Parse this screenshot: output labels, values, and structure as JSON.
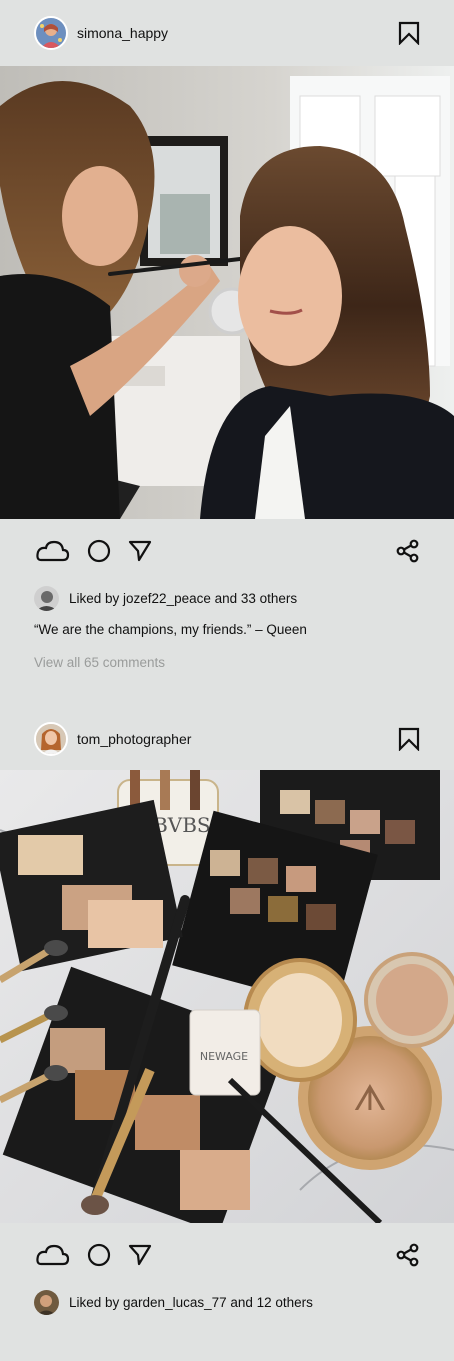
{
  "posts": [
    {
      "username": "simona_happy",
      "bookmark_icon": "bookmark-icon",
      "photo_description_icon": "photo-makeup-artist",
      "actions": {
        "like_icon": "cloud-icon",
        "comment_icon": "circle-icon",
        "send_icon": "send-icon",
        "share_icon": "share-icon"
      },
      "likes_text": "Liked by jozef22_peace and 33 others",
      "caption": "“We are the champions, my friends.” – Queen",
      "comments_link": "View all 65 comments"
    },
    {
      "username": "tom_photographer",
      "bookmark_icon": "bookmark-icon",
      "photo_description_icon": "photo-makeup-products",
      "actions": {
        "like_icon": "cloud-icon",
        "comment_icon": "circle-icon",
        "send_icon": "send-icon",
        "share_icon": "share-icon"
      },
      "likes_text": "Liked by garden_lucas_77 and 12 others"
    }
  ],
  "colors": {
    "background": "#e0e2e1",
    "secondary_text": "#9a9c9b"
  }
}
